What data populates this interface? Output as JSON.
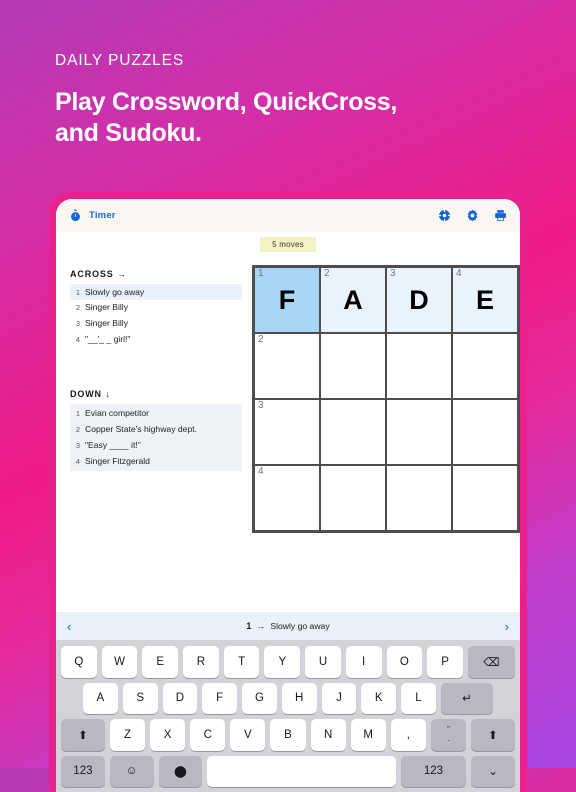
{
  "promo": {
    "kicker": "DAILY PUZZLES",
    "title_line1": "Play Crossword, QuickCross,",
    "title_line2": "and Sudoku."
  },
  "colors": {
    "accent_blue": "#1667d6",
    "active_cell": "#a7d5f5",
    "filled_cell": "#e9f3fd",
    "badge_yellow": "#f2f2c4",
    "clue_bar": "#e9f1fb",
    "bezel_pink": "#e8218c"
  },
  "app": {
    "toolbar": {
      "timer_label": "Timer",
      "timer_icon": "stopwatch-icon",
      "right_icons": [
        {
          "name": "puzzle-help-icon",
          "label": "Help"
        },
        {
          "name": "gear-icon",
          "label": "Settings"
        },
        {
          "name": "printer-icon",
          "label": "Print"
        }
      ]
    },
    "moves_badge": "5 moves",
    "across": {
      "heading": "ACROSS",
      "arrow": "→",
      "clues": [
        {
          "num": "1",
          "text": "Slowly go away",
          "highlight": true
        },
        {
          "num": "2",
          "text": "Singer Billy",
          "highlight": false
        },
        {
          "num": "3",
          "text": "Singer Billy",
          "highlight": false
        },
        {
          "num": "4",
          "text": "\"__'_ _ girl!\"",
          "highlight": false
        }
      ]
    },
    "down": {
      "heading": "DOWN",
      "arrow": "↓",
      "clues": [
        {
          "num": "1",
          "text": "Evian competitor"
        },
        {
          "num": "2",
          "text": "Copper State's highway dept."
        },
        {
          "num": "3",
          "text": "\"Easy ____ it!\""
        },
        {
          "num": "4",
          "text": "Singer Fitzgerald"
        }
      ]
    },
    "grid": {
      "rows": 4,
      "cols": 4,
      "cells": [
        {
          "num": "1",
          "letter": "F",
          "state": "active"
        },
        {
          "num": "2",
          "letter": "A",
          "state": "filled"
        },
        {
          "num": "3",
          "letter": "D",
          "state": "filled"
        },
        {
          "num": "4",
          "letter": "E",
          "state": "filled"
        },
        {
          "num": "2",
          "letter": "",
          "state": "empty"
        },
        {
          "num": "",
          "letter": "",
          "state": "empty"
        },
        {
          "num": "",
          "letter": "",
          "state": "empty"
        },
        {
          "num": "",
          "letter": "",
          "state": "empty"
        },
        {
          "num": "3",
          "letter": "",
          "state": "empty"
        },
        {
          "num": "",
          "letter": "",
          "state": "empty"
        },
        {
          "num": "",
          "letter": "",
          "state": "empty"
        },
        {
          "num": "",
          "letter": "",
          "state": "empty"
        },
        {
          "num": "4",
          "letter": "",
          "state": "empty"
        },
        {
          "num": "",
          "letter": "",
          "state": "empty"
        },
        {
          "num": "",
          "letter": "",
          "state": "empty"
        },
        {
          "num": "",
          "letter": "",
          "state": "empty"
        }
      ]
    },
    "clue_bar": {
      "prev": "‹",
      "next": "›",
      "number": "1",
      "arrow": "→",
      "text": "Slowly go away"
    },
    "keyboard": {
      "row1": [
        "Q",
        "W",
        "E",
        "R",
        "T",
        "Y",
        "U",
        "I",
        "O",
        "P"
      ],
      "row1_action": "⌫",
      "row2": [
        "A",
        "S",
        "D",
        "F",
        "G",
        "H",
        "J",
        "K",
        "L"
      ],
      "row2_action": "↵",
      "row3_shift_left": "⬆",
      "row3": [
        "Z",
        "X",
        "C",
        "V",
        "B",
        "N",
        "M",
        ","
      ],
      "row3_dual_top": "”",
      "row3_dual_bottom": ".",
      "row3_shift_right": "⬆",
      "row4_num_left": "123",
      "row4_emoji": "☺",
      "row4_mic": "⬤",
      "row4_space": "",
      "row4_num_right": "123",
      "row4_dismiss": "⌄"
    }
  }
}
